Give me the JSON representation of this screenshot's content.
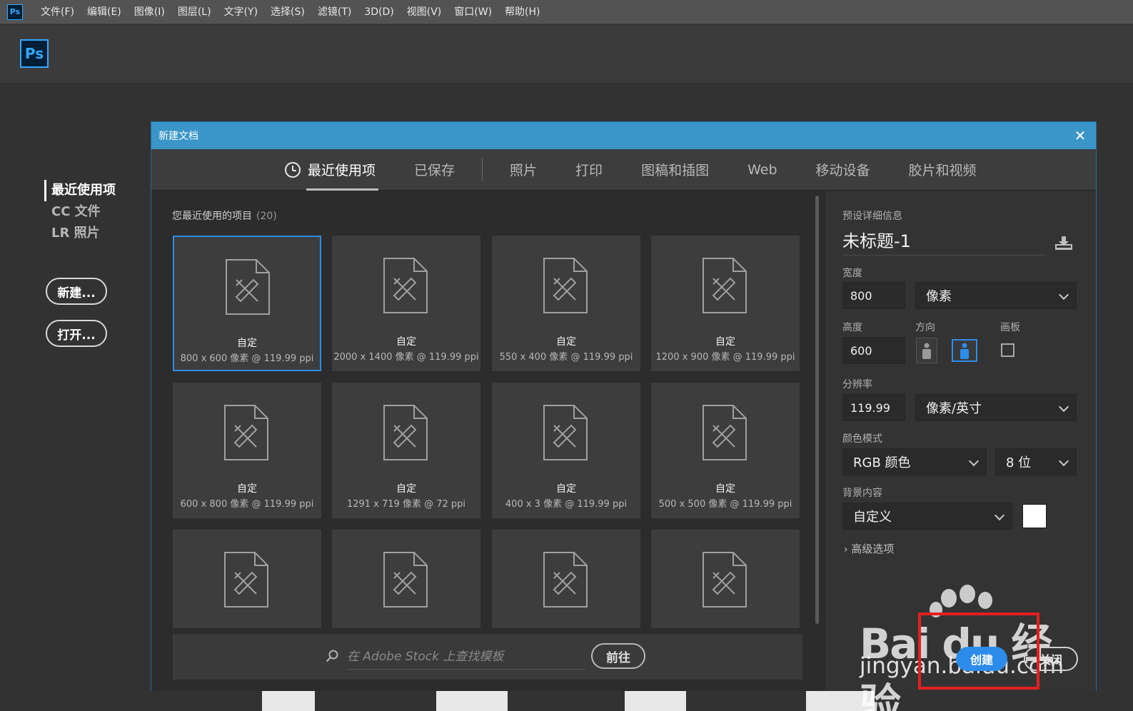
{
  "app": {
    "logo_text": "Ps"
  },
  "menubar": {
    "items": [
      "文件(F)",
      "编辑(E)",
      "图像(I)",
      "图层(L)",
      "文字(Y)",
      "选择(S)",
      "滤镜(T)",
      "3D(D)",
      "视图(V)",
      "窗口(W)",
      "帮助(H)"
    ]
  },
  "home_nav": {
    "items": [
      "最近使用项",
      "CC 文件",
      "LR 照片"
    ],
    "new_button": "新建...",
    "open_button": "打开..."
  },
  "dialog": {
    "title": "新建文档",
    "tabs": [
      "最近使用项",
      "已保存",
      "照片",
      "打印",
      "图稿和插图",
      "Web",
      "移动设备",
      "胶片和视频"
    ],
    "active_tab": "最近使用项"
  },
  "recent": {
    "heading": "您最近使用的项目",
    "count": "(20)",
    "presets": [
      {
        "name": "自定",
        "size": "800 x 600 像素 @ 119.99 ppi",
        "selected": true
      },
      {
        "name": "自定",
        "size": "2000 x 1400 像素 @ 119.99 ppi"
      },
      {
        "name": "自定",
        "size": "550 x 400 像素 @ 119.99 ppi"
      },
      {
        "name": "自定",
        "size": "1200 x 900 像素 @ 119.99 ppi"
      },
      {
        "name": "自定",
        "size": "600 x 800 像素 @ 119.99 ppi"
      },
      {
        "name": "自定",
        "size": "1291 x 719 像素 @ 72 ppi"
      },
      {
        "name": "自定",
        "size": "400 x 3 像素 @ 119.99 ppi"
      },
      {
        "name": "自定",
        "size": "500 x 500 像素 @ 119.99 ppi"
      },
      {
        "name": "",
        "size": ""
      },
      {
        "name": "",
        "size": ""
      },
      {
        "name": "",
        "size": ""
      },
      {
        "name": "",
        "size": ""
      }
    ]
  },
  "stock": {
    "placeholder": "在 Adobe Stock 上查找模板",
    "go_button": "前往"
  },
  "details": {
    "section_title": "预设详细信息",
    "doc_name": "未标题-1",
    "width_label": "宽度",
    "width_value": "800",
    "width_unit": "像素",
    "height_label": "高度",
    "height_value": "600",
    "orientation_label": "方向",
    "artboard_label": "画板",
    "resolution_label": "分辨率",
    "resolution_value": "119.99",
    "resolution_unit": "像素/英寸",
    "color_mode_label": "颜色模式",
    "color_mode_value": "RGB 颜色",
    "bit_depth": "8 位",
    "background_label": "背景内容",
    "background_value": "自定义",
    "background_swatch": "#ffffff",
    "advanced_label": "高级选项",
    "create_button": "创建",
    "close_button": "关闭"
  },
  "watermark": {
    "brand": "Bai du 经验",
    "site": "jingyan.baidu.com"
  },
  "colors": {
    "accent": "#2d8ceb",
    "title_bar": "#3a95c8",
    "highlight_box": "#e32020"
  }
}
